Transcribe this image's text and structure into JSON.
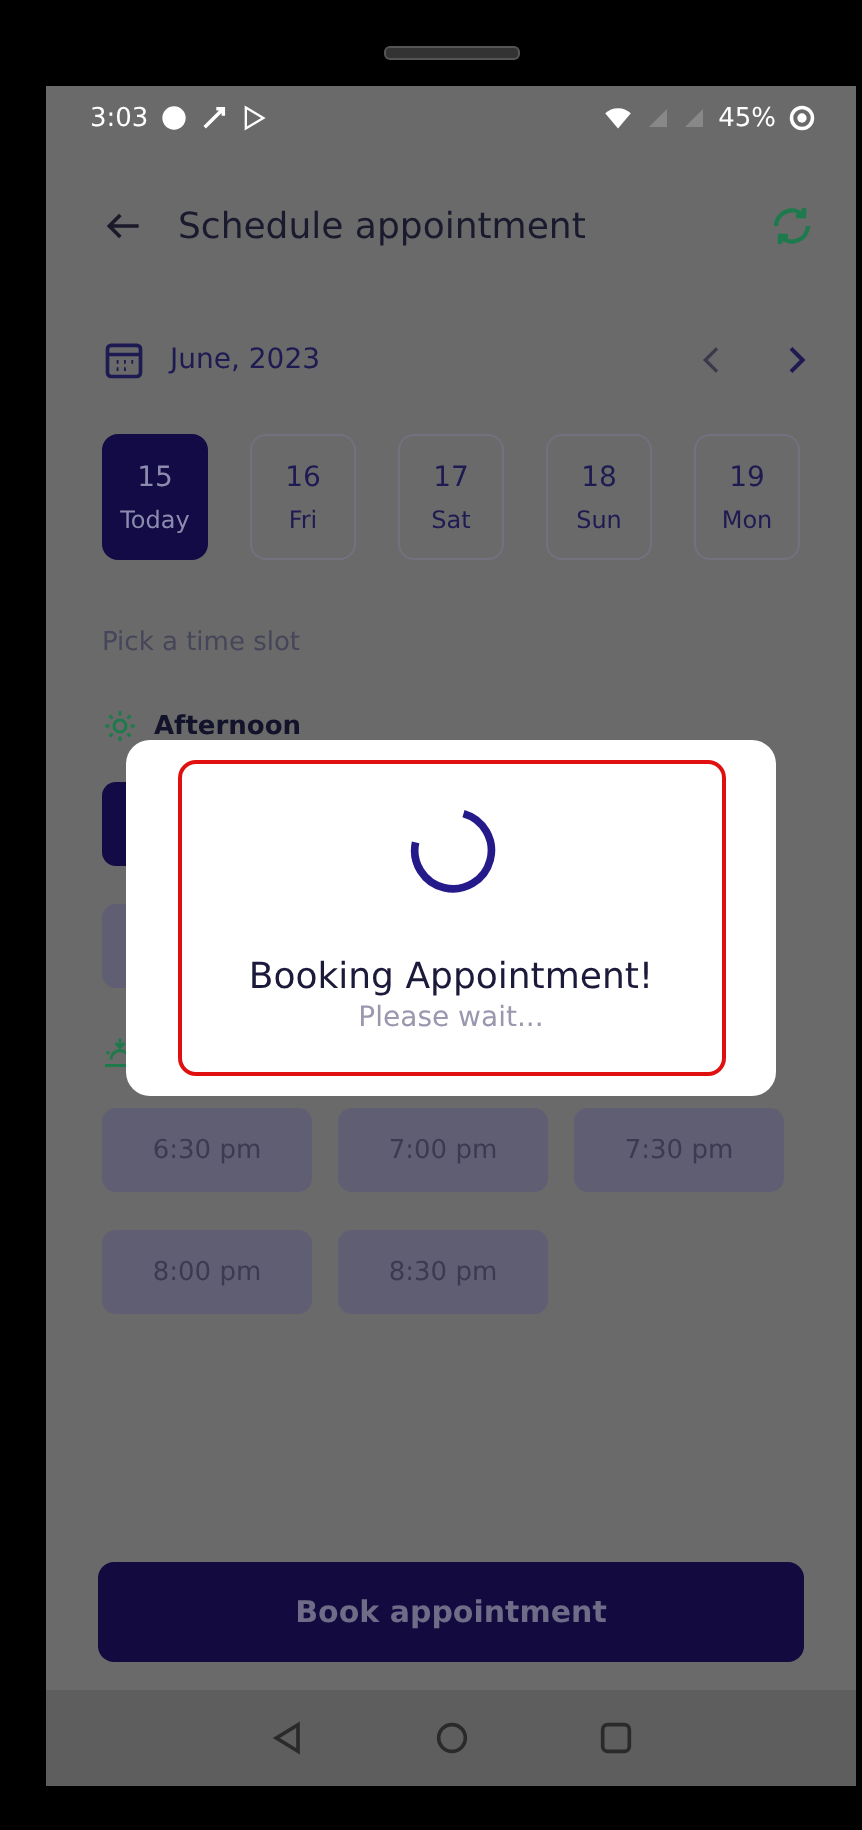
{
  "status_bar": {
    "time": "3:03",
    "battery": "45%"
  },
  "header": {
    "title": "Schedule appointment"
  },
  "calendar": {
    "month": "June, 2023",
    "days": [
      {
        "number": "15",
        "label": "Today",
        "selected": true
      },
      {
        "number": "16",
        "label": "Fri",
        "selected": false
      },
      {
        "number": "17",
        "label": "Sat",
        "selected": false
      },
      {
        "number": "18",
        "label": "Sun",
        "selected": false
      },
      {
        "number": "19",
        "label": "Mon",
        "selected": false
      }
    ]
  },
  "prompt": "Pick a time slot",
  "sections": [
    {
      "kind": "sun",
      "title": "Afternoon",
      "slots": [
        {
          "selected": true
        },
        {
          "selected": false
        }
      ]
    },
    {
      "kind": "sunset",
      "slots": [
        {
          "time": "6:30 pm",
          "selected": false
        },
        {
          "time": "7:00 pm",
          "selected": false
        },
        {
          "time": "7:30 pm",
          "selected": false
        },
        {
          "time": "8:00 pm",
          "selected": false
        },
        {
          "time": "8:30 pm",
          "selected": false
        }
      ]
    }
  ],
  "book_button": "Book appointment",
  "dialog": {
    "title": "Booking Appointment!",
    "message": "Please wait..."
  }
}
